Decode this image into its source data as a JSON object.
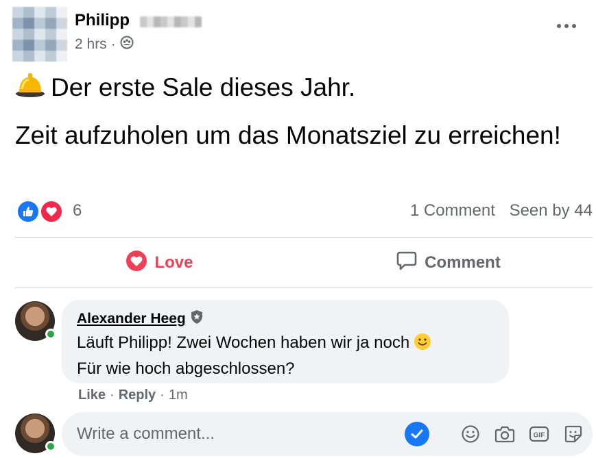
{
  "post": {
    "author": "Philipp",
    "time": "2 hrs",
    "separator": "·",
    "audience_icon": "group-audience-icon",
    "more_icon": "more-options-icon",
    "line1": "Der erste Sale dieses Jahr.",
    "line2": "Zeit aufzuholen um das Monatsziel zu erreichen!",
    "bell_icon": "bell-emoji-icon"
  },
  "reactions": {
    "count": "6",
    "types": [
      "like",
      "love"
    ],
    "comments": "1 Comment",
    "seen": "Seen by 44"
  },
  "actions": {
    "love_label": "Love",
    "comment_label": "Comment"
  },
  "comment": {
    "author": "Alexander Heeg",
    "badge_icon": "shield-badge-icon",
    "line1": "Läuft Philipp! Zwei Wochen haben wir ja noch",
    "line2": "Für wie hoch abgeschlossen?",
    "like": "Like",
    "sep1": "·",
    "reply": "Reply",
    "sep2": "·",
    "time": "1m"
  },
  "composer": {
    "placeholder": "Write a comment...",
    "tools": [
      "check-icon",
      "emoji-icon",
      "camera-icon",
      "gif-icon",
      "sticker-icon"
    ]
  },
  "colors": {
    "like_blue": "#1877f2",
    "love_red": "#f33e58",
    "online_green": "#31a24c",
    "bubble_bg": "#f0f2f5"
  }
}
